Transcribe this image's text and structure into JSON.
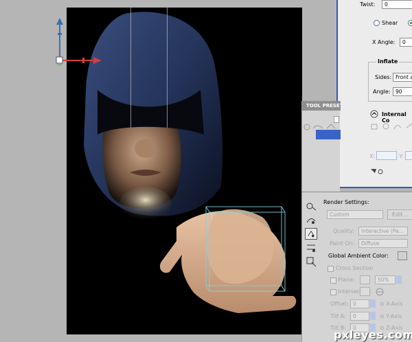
{
  "dialog": {
    "twist_label": "Twist:",
    "twist_value": "0",
    "shear_label": "Shear",
    "x_angle_label": "X Angle:",
    "x_angle_value": "0",
    "inflate_title": "Inflate",
    "sides_label": "Sides:",
    "sides_value": "Front a",
    "angle_label": "Angle:",
    "angle_value": "90",
    "internal_label": "Internal Co",
    "x_label": "X:",
    "y_label": "Y:"
  },
  "presets": {
    "tab_label": "TOOL PRESETS"
  },
  "render": {
    "title": "Render Settings:",
    "preset_value": "Custom",
    "edit_label": "Edit...",
    "quality_label": "Quality:",
    "quality_value": "Interactive (Pa...",
    "paint_on_label": "Paint On:",
    "paint_on_value": "Diffuse",
    "ambient_label": "Global Ambient Color:",
    "cross_section_label": "Cross Section",
    "plane_label": "Plane:",
    "plane_value": "50%",
    "intersection_label": "Intersection:",
    "offset_label": "Offset:",
    "offset_value": "0",
    "offset_axis": "X-Axis",
    "tilt_a_label": "Tilt A:",
    "tilt_a_value": "0",
    "tilt_a_axis": "Y-Axis",
    "tilt_b_label": "Tilt B:",
    "tilt_b_value": "0",
    "tilt_b_axis": "Z-Axis"
  },
  "watermark": "pxleyes.com",
  "colors": {
    "dialog_border": "#2f57b8",
    "axis_y": "#3b6fb5",
    "axis_x": "#d24040",
    "preset_highlight": "#3a63c7",
    "bounding_box": "#7fd3e0"
  }
}
